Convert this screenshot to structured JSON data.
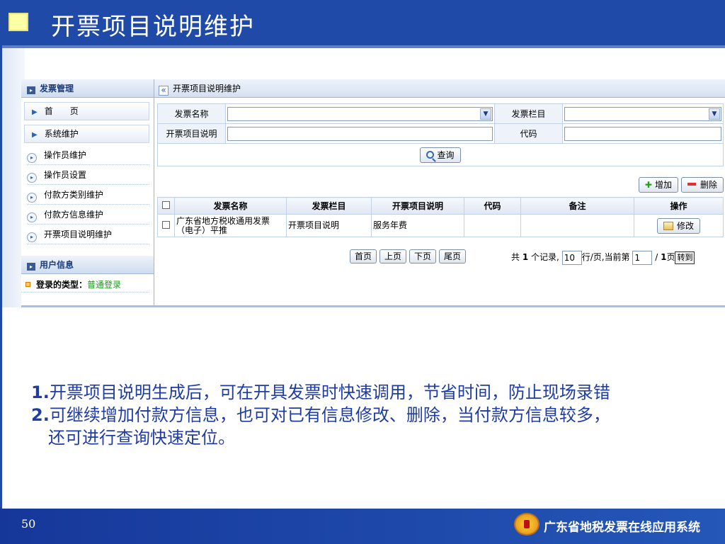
{
  "slide": {
    "title": "开票项目说明维护",
    "page_number": "50",
    "footer_system": "广东省地税发票在线应用系统",
    "bullets": [
      {
        "num": "1.",
        "text": "开票项目说明生成后，可在开具发票时快速调用，节省时间，防止现场录错"
      },
      {
        "num": "2.",
        "text": "可继续增加付款方信息，也可对已有信息修改、删除，当付款方信息较多，",
        "cont": "还可进行查询快速定位。"
      }
    ]
  },
  "sidebar": {
    "section1_title": "发票管理",
    "main_items": [
      {
        "label": "首　　页"
      },
      {
        "label": "系统维护"
      }
    ],
    "sub_items": [
      {
        "label": "操作员维护"
      },
      {
        "label": "操作员设置"
      },
      {
        "label": "付款方类别维护"
      },
      {
        "label": "付款方信息维护"
      },
      {
        "label": "开票项目说明维护"
      }
    ],
    "section2_title": "用户信息",
    "login_label": "登录的类型：",
    "login_value": "普通登录"
  },
  "main": {
    "breadcrumb": "开票项目说明维护",
    "form": {
      "invoice_name_label": "发票名称",
      "invoice_name_value": "",
      "invoice_column_label": "发票栏目",
      "invoice_column_value": "",
      "item_desc_label": "开票项目说明",
      "item_desc_value": "",
      "code_label": "代码",
      "code_value": "",
      "query_button": "查询"
    },
    "add_button": "增加",
    "delete_button": "删除",
    "table": {
      "headers": [
        "发票名称",
        "发票栏目",
        "开票项目说明",
        "代码",
        "备注",
        "操作"
      ],
      "rows": [
        {
          "invoice_name": "广东省地方税收通用发票（电子）平推",
          "invoice_column": "开票项目说明",
          "item_desc": "服务年费",
          "code": "",
          "remark": "",
          "action": "修改"
        }
      ]
    },
    "pager": {
      "first": "首页",
      "prev": "上页",
      "next": "下页",
      "last": "尾页",
      "total_prefix": "共",
      "total_count": "1",
      "records_text": "个记录,",
      "page_size": "10",
      "per_page_text": "行/页,当前第",
      "current_page": "1",
      "slash": "/",
      "total_pages": "1",
      "page_suffix": "页",
      "goto": "转到"
    }
  },
  "colors": {
    "header_blue": "#1f4aa8",
    "bullet_text": "#1f3ca6",
    "login_green": "#1a9a1a"
  }
}
